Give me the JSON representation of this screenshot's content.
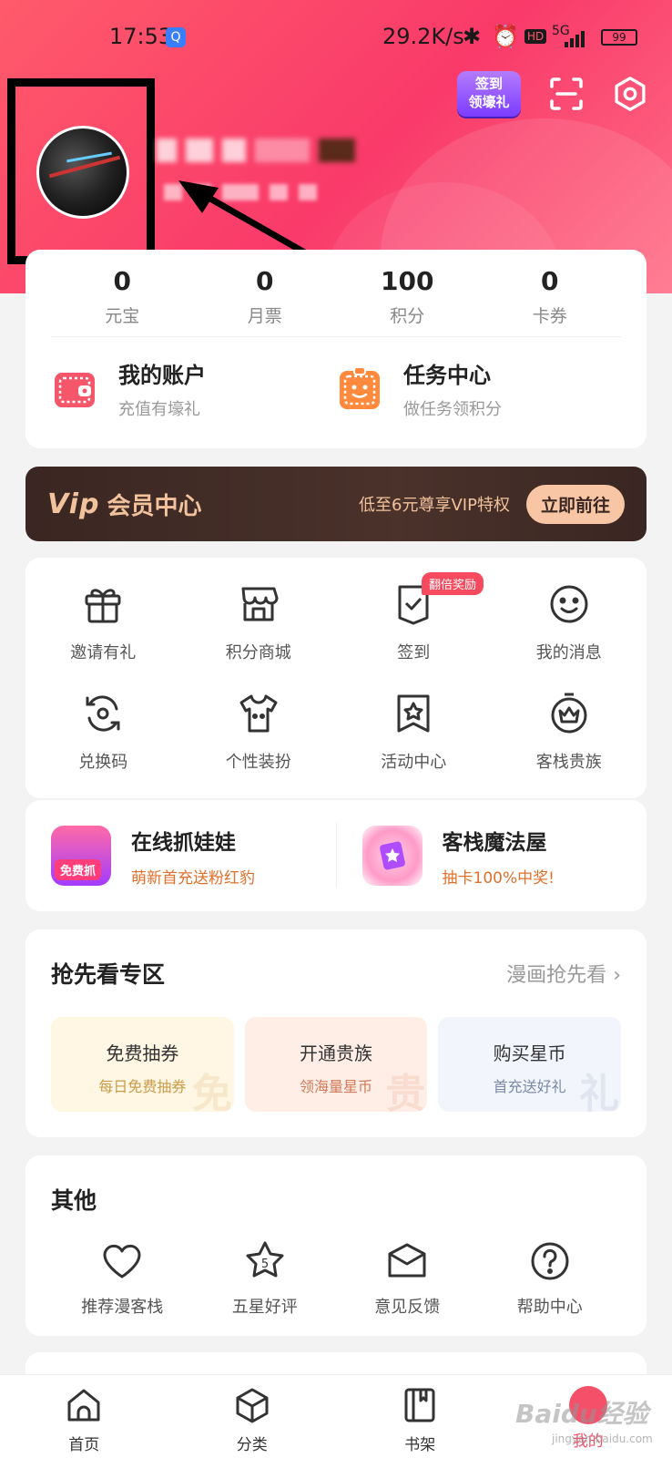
{
  "status_bar": {
    "time": "17:53",
    "net_speed": "29.2K/s",
    "hd": "HD",
    "signal": "5G",
    "battery": "99"
  },
  "header": {
    "signin_badge_line1": "签到",
    "signin_badge_line2": "领壕礼"
  },
  "stats": [
    {
      "value": "0",
      "label": "元宝"
    },
    {
      "value": "0",
      "label": "月票"
    },
    {
      "value": "100",
      "label": "积分"
    },
    {
      "value": "0",
      "label": "卡券"
    }
  ],
  "accounts": [
    {
      "title": "我的账户",
      "subtitle": "充值有壕礼"
    },
    {
      "title": "任务中心",
      "subtitle": "做任务领积分"
    }
  ],
  "vip": {
    "logo": "Vip",
    "title": "会员中心",
    "desc": "低至6元尊享VIP特权",
    "button": "立即前往"
  },
  "grid": {
    "items": [
      {
        "label": "邀请有礼",
        "icon": "gift-icon"
      },
      {
        "label": "积分商城",
        "icon": "store-icon"
      },
      {
        "label": "签到",
        "icon": "checkin-icon",
        "tag": "翻倍奖励"
      },
      {
        "label": "我的消息",
        "icon": "smile-icon"
      },
      {
        "label": "兑换码",
        "icon": "exchange-icon"
      },
      {
        "label": "个性装扮",
        "icon": "shirt-icon"
      },
      {
        "label": "活动中心",
        "icon": "star-bookmark-icon"
      },
      {
        "label": "客栈贵族",
        "icon": "crown-icon"
      }
    ]
  },
  "promos": [
    {
      "title": "在线抓娃娃",
      "subtitle": "萌新首充送粉红豹",
      "badge": "免费抓"
    },
    {
      "title": "客栈魔法屋",
      "subtitle": "抽卡100%中奖!"
    }
  ],
  "early": {
    "title": "抢先看专区",
    "more": "漫画抢先看",
    "items": [
      {
        "title": "免费抽券",
        "subtitle": "每日免费抽券",
        "watermark": "免",
        "bg": "#fff6e3",
        "fg": "#c89b4a"
      },
      {
        "title": "开通贵族",
        "subtitle": "领海量星币",
        "watermark": "贵",
        "bg": "#ffeee6",
        "fg": "#d07a5a"
      },
      {
        "title": "购买星币",
        "subtitle": "首充送好礼",
        "watermark": "礼",
        "bg": "#f2f5fc",
        "fg": "#7a8aa8"
      }
    ]
  },
  "other": {
    "title": "其他",
    "items": [
      {
        "label": "推荐漫客栈",
        "icon": "heart-icon"
      },
      {
        "label": "五星好评",
        "icon": "five-star-icon"
      },
      {
        "label": "意见反馈",
        "icon": "feedback-icon"
      },
      {
        "label": "帮助中心",
        "icon": "help-icon"
      }
    ]
  },
  "tabbar": [
    {
      "label": "首页",
      "icon": "home-icon"
    },
    {
      "label": "分类",
      "icon": "category-icon"
    },
    {
      "label": "书架",
      "icon": "bookshelf-icon"
    },
    {
      "label": "我的",
      "icon": "me-icon",
      "active": true
    }
  ],
  "watermark": {
    "main": "Baidu经验",
    "sub": "jingyan.baidu.com"
  },
  "colors": {
    "brand": "#f64a5e",
    "vip_gold": "#f2c29c",
    "accent_orange": "#e0702b"
  }
}
